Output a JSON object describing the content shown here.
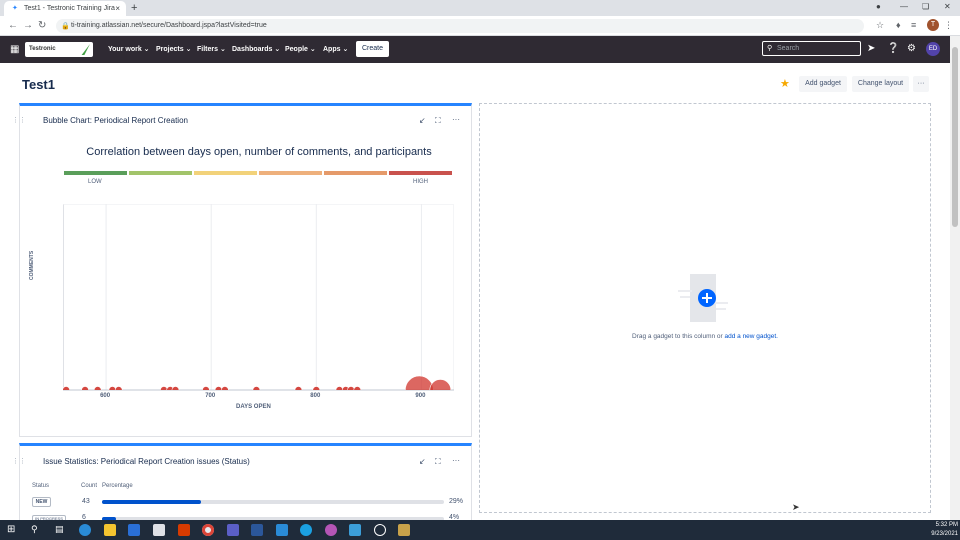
{
  "browser": {
    "tab_title": "Test1 - Testronic Training Jira",
    "url": "ti-training.atlassian.net/secure/Dashboard.jspa?lastVisited=true",
    "profile_initial": "T"
  },
  "nav": {
    "logo_text": "Testronic",
    "items": [
      "Your work",
      "Projects",
      "Filters",
      "Dashboards",
      "People",
      "Apps"
    ],
    "create_label": "Create",
    "search_placeholder": "Search",
    "user_initials": "ED"
  },
  "dashboard": {
    "title": "Test1",
    "add_gadget_label": "Add gadget",
    "change_layout_label": "Change layout",
    "more_label": "···"
  },
  "bubble_gadget": {
    "title": "Bubble Chart: Periodical Report Creation",
    "chart_data": {
      "type": "scatter",
      "title": "Correlation between days open, number of comments, and participants",
      "xlabel": "DAYS OPEN",
      "ylabel": "COMMENTS",
      "xlim": [
        559,
        931
      ],
      "ylim": [
        0,
        10
      ],
      "xticks": [
        600,
        700,
        800,
        900
      ],
      "legend_low": "LOW",
      "legend_high": "HIGH",
      "legend_colors": [
        "#5a9e5a",
        "#a2c46a",
        "#f2d27a",
        "#eeb07c",
        "#e59a6a",
        "#c9524d"
      ],
      "bubble_color": "#d0342c",
      "points": [
        {
          "x": 562,
          "y": 0,
          "size": 1
        },
        {
          "x": 580,
          "y": 0,
          "size": 1
        },
        {
          "x": 592,
          "y": 0,
          "size": 1
        },
        {
          "x": 606,
          "y": 0,
          "size": 1
        },
        {
          "x": 612,
          "y": 0,
          "size": 1
        },
        {
          "x": 655,
          "y": 0,
          "size": 1
        },
        {
          "x": 661,
          "y": 0,
          "size": 1
        },
        {
          "x": 666,
          "y": 0,
          "size": 1
        },
        {
          "x": 695,
          "y": 0,
          "size": 1
        },
        {
          "x": 707,
          "y": 0,
          "size": 1
        },
        {
          "x": 713,
          "y": 0,
          "size": 1
        },
        {
          "x": 743,
          "y": 0,
          "size": 1
        },
        {
          "x": 783,
          "y": 0,
          "size": 1
        },
        {
          "x": 800,
          "y": 0,
          "size": 1
        },
        {
          "x": 822,
          "y": 0,
          "size": 1
        },
        {
          "x": 828,
          "y": 0,
          "size": 1
        },
        {
          "x": 833,
          "y": 0,
          "size": 1
        },
        {
          "x": 839,
          "y": 0,
          "size": 1
        },
        {
          "x": 898,
          "y": 0,
          "size": 4
        },
        {
          "x": 918,
          "y": 0,
          "size": 3
        }
      ]
    }
  },
  "stats_gadget": {
    "title": "Issue Statistics: Periodical Report Creation issues (Status)",
    "col_status": "Status",
    "col_count": "Count",
    "col_percentage": "Percentage",
    "rows": [
      {
        "status": "NEW",
        "count": "43",
        "percent": "29%",
        "fraction": 0.29
      },
      {
        "status": "IN PROGRESS",
        "count": "6",
        "percent": "4%",
        "fraction": 0.04
      }
    ]
  },
  "empty_column": {
    "text_prefix": "Drag a gadget to this column or ",
    "link_text": "add a new gadget.",
    "text_suffix": ""
  },
  "taskbar": {
    "time": "5:32 PM",
    "date": "9/23/2021"
  }
}
